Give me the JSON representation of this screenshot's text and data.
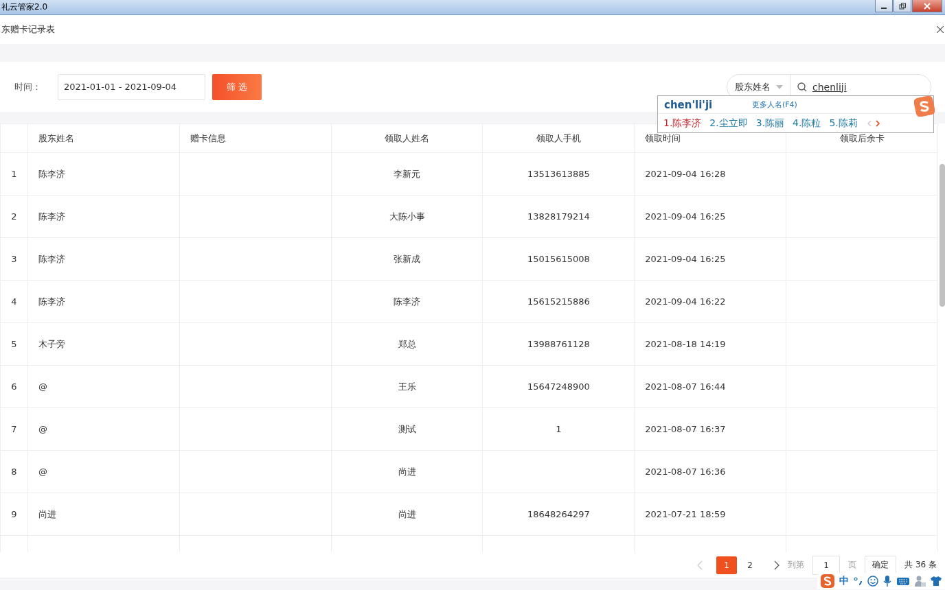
{
  "window": {
    "title": "礼云管家2.0"
  },
  "page": {
    "title": "东赠卡记录表"
  },
  "filter": {
    "label": "时间：",
    "date_range": "2021-01-01 - 2021-09-04",
    "button": "筛 选",
    "search_type": "股东姓名",
    "search_value": "chenliji"
  },
  "ime": {
    "composition": "chen'li'ji",
    "more": "更多人名(F4)",
    "candidates": [
      {
        "text": "1.陈李济",
        "selected": true
      },
      {
        "text": "2.尘立即",
        "selected": false
      },
      {
        "text": "3.陈丽",
        "selected": false
      },
      {
        "text": "4.陈粒",
        "selected": false
      },
      {
        "text": "5.陈莉",
        "selected": false
      }
    ],
    "status": "中"
  },
  "table": {
    "columns": [
      "股东姓名",
      "赠卡信息",
      "领取人姓名",
      "领取人手机",
      "领取时间",
      "领取后余卡"
    ],
    "rows": [
      {
        "index": "1",
        "name": "陈李济",
        "receiver": "李新元",
        "phone": "13513613885",
        "time": "2021-09-04 16:28"
      },
      {
        "index": "2",
        "name": "陈李济",
        "receiver": "大陈小事",
        "phone": "13828179214",
        "time": "2021-09-04 16:25"
      },
      {
        "index": "3",
        "name": "陈李济",
        "receiver": "张新成",
        "phone": "15015615008",
        "time": "2021-09-04 16:25"
      },
      {
        "index": "4",
        "name": "陈李济",
        "receiver": "陈李济",
        "phone": "15615215886",
        "time": "2021-09-04 16:22"
      },
      {
        "index": "5",
        "name": "木子旁",
        "receiver": "郑总",
        "phone": "13988761128",
        "time": "2021-08-18 14:19"
      },
      {
        "index": "6",
        "name": "@",
        "receiver": "王乐",
        "phone": "15647248900",
        "time": "2021-08-07 16:44"
      },
      {
        "index": "7",
        "name": "@",
        "receiver": "测试",
        "phone": "1",
        "time": "2021-08-07 16:37"
      },
      {
        "index": "8",
        "name": "@",
        "receiver": "尚进",
        "time": "2021-08-07 16:36"
      },
      {
        "index": "9",
        "name": "尚进",
        "receiver": "尚进",
        "phone": "18648264297",
        "time": "2021-07-21 18:59"
      }
    ]
  },
  "pagination": {
    "pages": [
      {
        "label": "1",
        "selected": true
      },
      {
        "label": "2",
        "selected": false
      }
    ],
    "goto_label": "到第",
    "goto_value": "1",
    "page_unit": "页",
    "confirm": "确定",
    "total": "共 36 条"
  }
}
